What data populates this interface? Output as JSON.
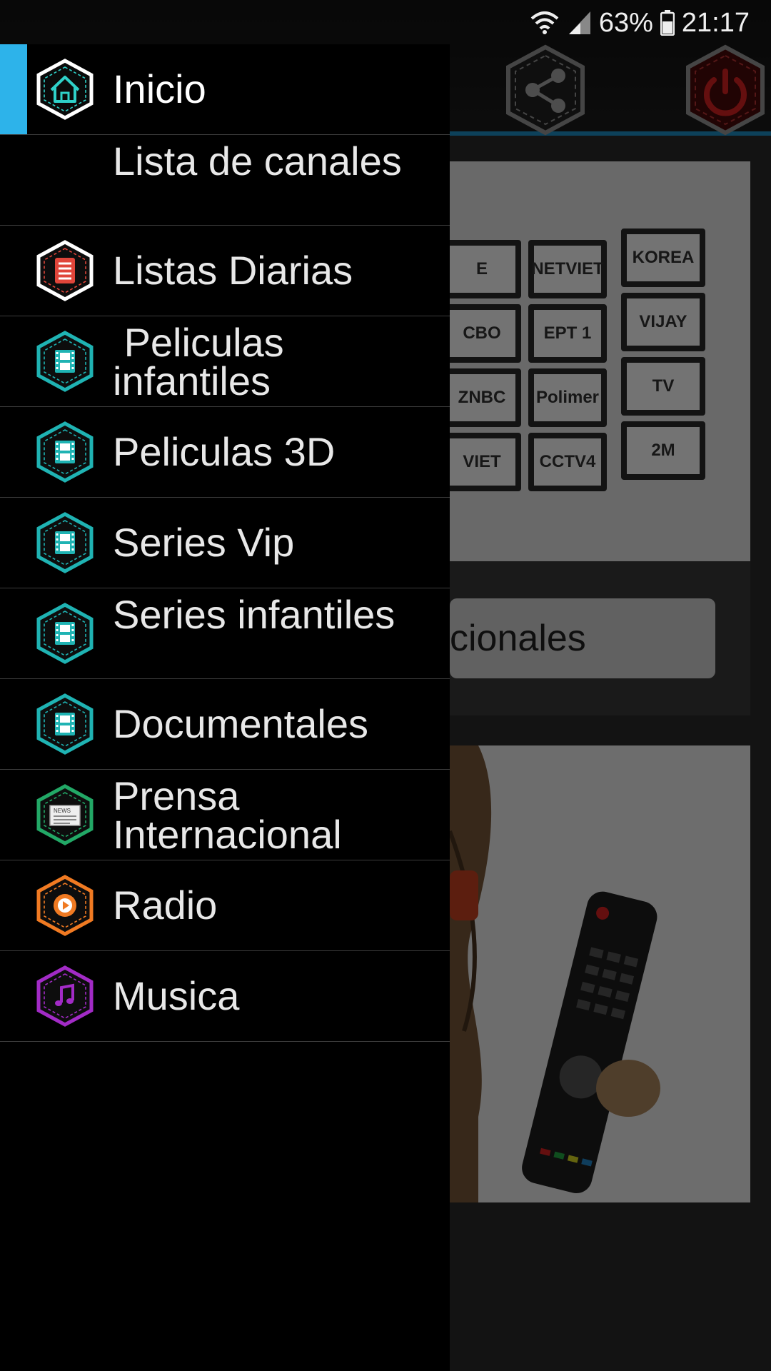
{
  "status_bar": {
    "battery": "63%",
    "time": "21:17"
  },
  "background": {
    "button_partial_text": "cionales",
    "tv_logos": [
      "E",
      "NETVIET",
      "KOREA",
      "CBO",
      "EPT 1",
      "VIJAY",
      "ZNBC",
      "Polimer",
      "TV",
      "VIET",
      "CCTV4",
      "2M"
    ]
  },
  "drawer": {
    "items": [
      {
        "label": "Inicio",
        "icon": "home-icon",
        "color": "#2fd1c9",
        "active": true
      },
      {
        "label": "Lista de canales",
        "icon": "",
        "color": "",
        "active": false
      },
      {
        "label": "Listas Diarias",
        "icon": "list-icon",
        "color": "#e0453a",
        "active": false
      },
      {
        "label": " Peliculas infantiles",
        "icon": "film-icon",
        "color": "#1fb3b3",
        "active": false
      },
      {
        "label": "Peliculas 3D",
        "icon": "film-icon",
        "color": "#1fb3b3",
        "active": false
      },
      {
        "label": "Series Vip",
        "icon": "film-icon",
        "color": "#1fb3b3",
        "active": false
      },
      {
        "label": "Series infantiles",
        "icon": "film-icon",
        "color": "#1fb3b3",
        "active": false
      },
      {
        "label": "Documentales",
        "icon": "film-icon",
        "color": "#1fb3b3",
        "active": false
      },
      {
        "label": "Prensa Internacional",
        "icon": "newspaper-icon",
        "color": "#22a866",
        "active": false
      },
      {
        "label": "Radio",
        "icon": "play-circle-icon",
        "color": "#f07a22",
        "active": false
      },
      {
        "label": "Musica",
        "icon": "music-note-icon",
        "color": "#a22bc6",
        "active": false
      }
    ]
  }
}
